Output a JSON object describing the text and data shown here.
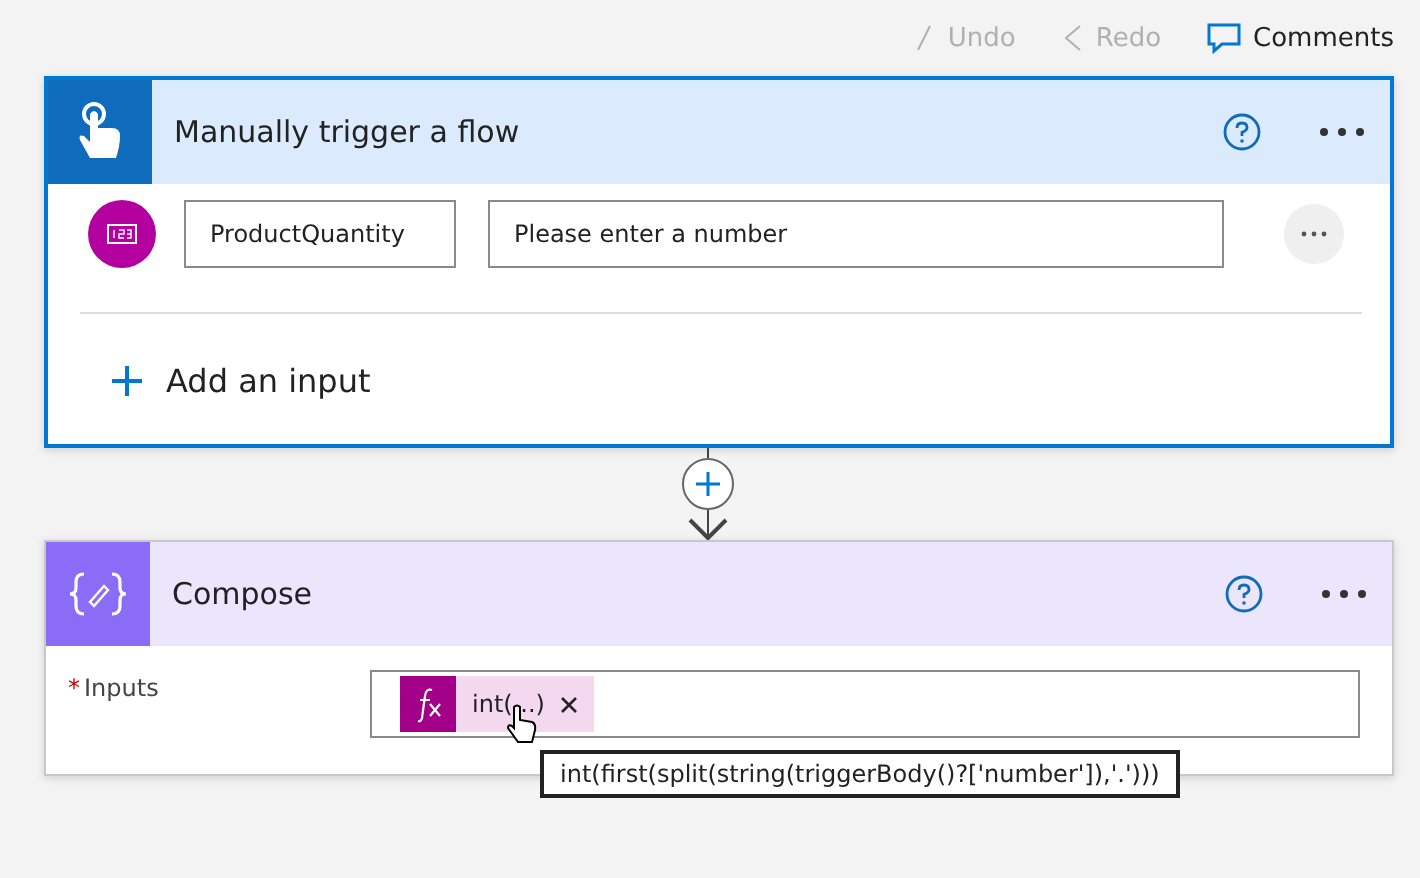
{
  "toolbar": [
    {
      "label": "Undo",
      "disabled": true,
      "kind": "undo"
    },
    {
      "label": "Redo",
      "disabled": true,
      "kind": "redo"
    },
    {
      "label": "Comments",
      "disabled": false,
      "kind": "comments"
    }
  ],
  "trigger": {
    "title": "Manually trigger a flow",
    "selected": true,
    "inputs": [
      {
        "name": "ProductQuantity",
        "placeholder": "Please enter a number"
      }
    ],
    "add_label": "Add an input"
  },
  "compose": {
    "title": "Compose",
    "selected": false,
    "field_label": "Inputs",
    "required_mark": "*",
    "token": {
      "label": "int(...)"
    },
    "tooltip": "int(first(split(string(triggerBody()?['number']),'.')))"
  }
}
